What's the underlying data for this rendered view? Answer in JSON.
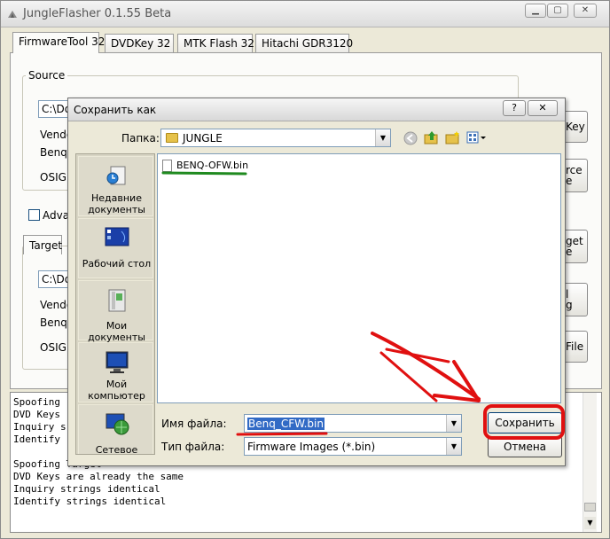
{
  "app": {
    "title": "JungleFlasher 0.1.55 Beta",
    "tabs": [
      "FirmwareTool 32",
      "DVDKey 32",
      "MTK Flash 32",
      "Hitachi GDR3120"
    ],
    "source": {
      "group_label": "Source",
      "path_value": "C:\\Do",
      "vendor_label": "Vendo",
      "vendor_value": "Benq",
      "osig_label": "OSIG:"
    },
    "advanced_label": "Advan",
    "target": {
      "group_label": "Target",
      "path_value": "C:\\Do",
      "vendor_label": "Vendo",
      "vendor_value": "Benq",
      "osig_label": "OSIG:"
    },
    "right_buttons": [
      {
        "label": "Key"
      },
      {
        "label": "rce\ne"
      },
      {
        "label": "get\ne"
      },
      {
        "label": "l\ng"
      },
      {
        "label": "File"
      }
    ],
    "window_buttons": [
      "minimize",
      "maximize",
      "close"
    ],
    "log_lines": [
      "Spoofing",
      "DVD Keys",
      "Inquiry s",
      "Identify",
      "",
      "Spoofing Target",
      "DVD Keys are already the same",
      "Inquiry strings identical",
      "Identify strings identical"
    ]
  },
  "dialog": {
    "title": "Сохранить как",
    "folder_label": "Папка:",
    "folder_value": "JUNGLE",
    "places": [
      {
        "label": "Недавние документы",
        "icon": "recent-documents-icon"
      },
      {
        "label": "Рабочий стол",
        "icon": "desktop-icon"
      },
      {
        "label": "Мои документы",
        "icon": "my-documents-icon"
      },
      {
        "label": "Мой компьютер",
        "icon": "my-computer-icon"
      },
      {
        "label": "Сетевое",
        "icon": "network-icon"
      }
    ],
    "files": [
      {
        "name": "BENQ-OFW.bin"
      }
    ],
    "filename_label": "Имя файла:",
    "filename_value": "Benq_CFW.bin",
    "filetype_label": "Тип файла:",
    "filetype_value": "Firmware Images (*.bin)",
    "save_label": "Сохранить",
    "cancel_label": "Отмена",
    "help_label": "?",
    "close_label": "✕"
  },
  "colors": {
    "annotation_red": "#e01010",
    "annotation_green": "#1f8a1f",
    "selection_blue": "#316ac5"
  }
}
